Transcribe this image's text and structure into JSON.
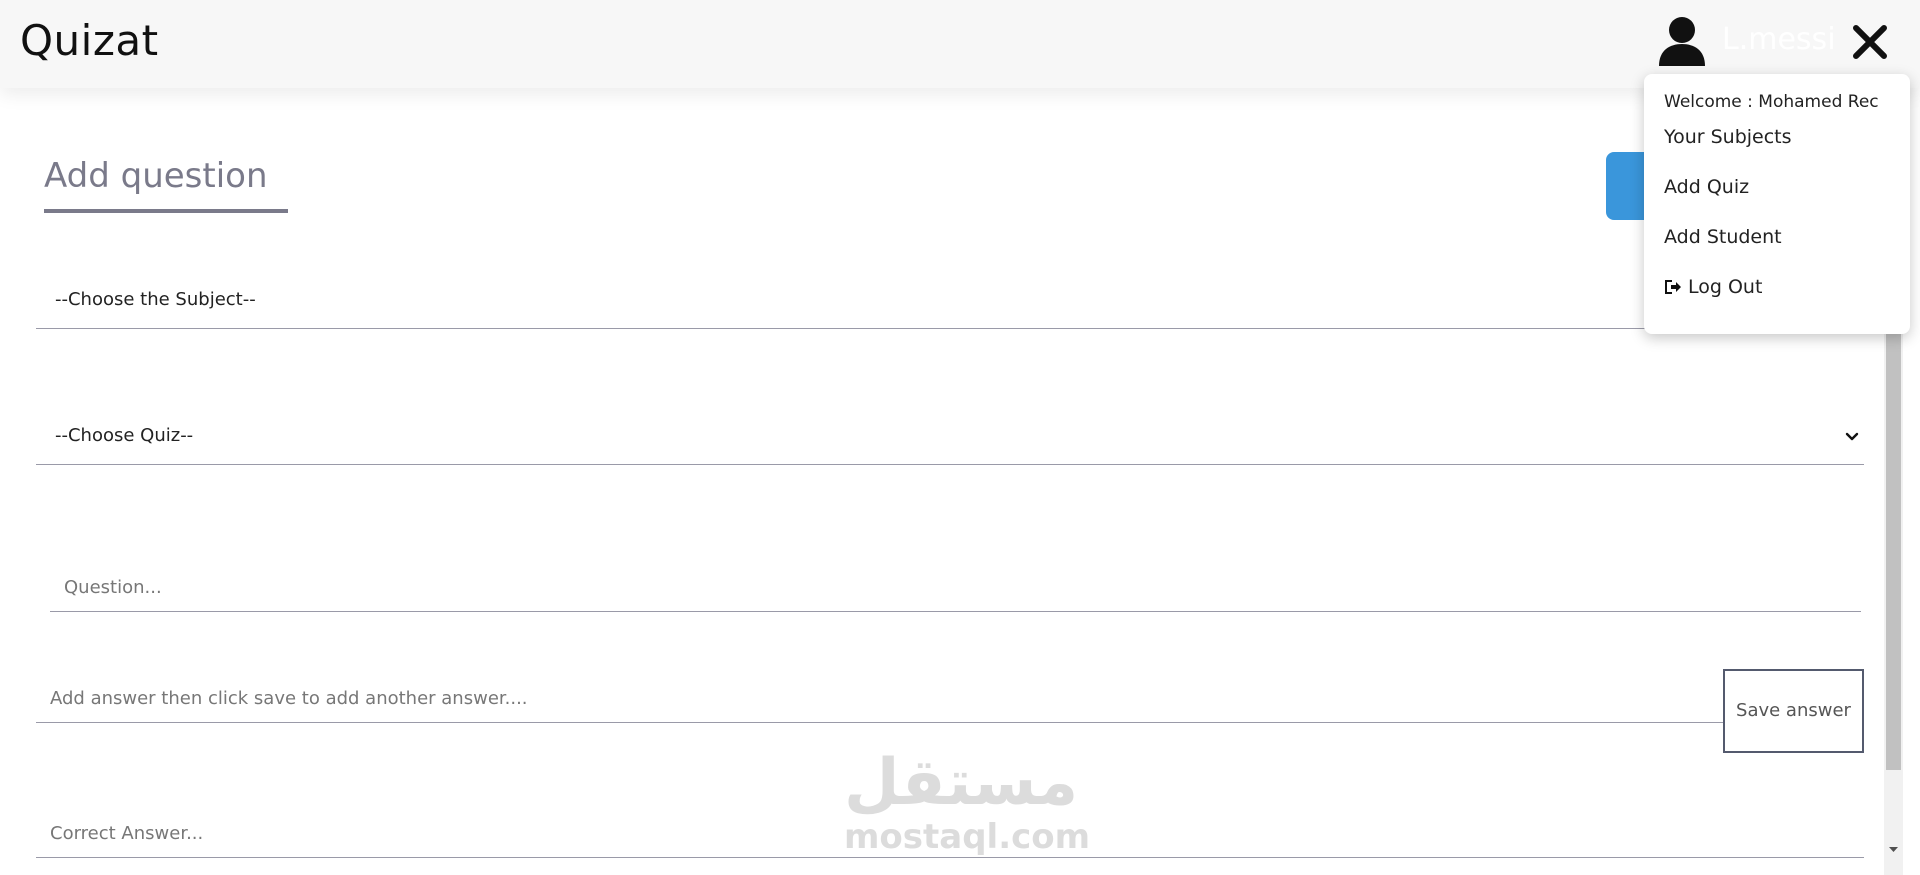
{
  "navbar": {
    "brand": "Quizat",
    "username": "L.messi",
    "user_icon": "user-icon",
    "close_icon": "close-icon"
  },
  "user_menu": {
    "welcome": "Welcome : Mohamed Rec",
    "items": [
      {
        "label": "Your Subjects"
      },
      {
        "label": "Add Quiz"
      },
      {
        "label": "Add Student"
      },
      {
        "label": "Log Out",
        "icon": "logout-icon"
      }
    ]
  },
  "form": {
    "title": "Add question",
    "subject_select": {
      "selected": "--Choose the Subject--"
    },
    "quiz_select": {
      "selected": "--Choose Quiz--"
    },
    "question_input": {
      "placeholder": "Question...",
      "value": ""
    },
    "answer_input": {
      "placeholder": "Add answer then click save to add another answer....",
      "value": ""
    },
    "save_answer_label": "Save answer",
    "correct_answer_input": {
      "placeholder": "Correct Answer...",
      "value": ""
    }
  },
  "watermark": {
    "arabic": "مستقل",
    "latin": "mostaql.com"
  },
  "colors": {
    "accent_blue": "#3a96db",
    "title_gray": "#7a7a8a",
    "navbar_bg": "#f7f7f7"
  }
}
